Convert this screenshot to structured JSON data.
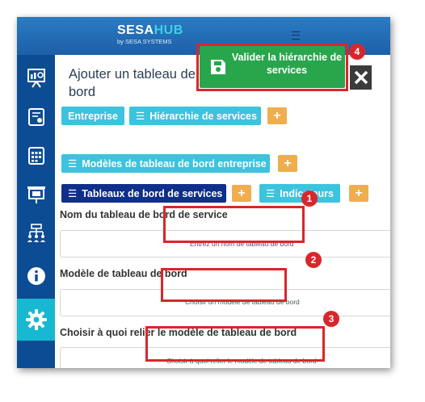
{
  "header": {
    "logo_main": "SESA",
    "logo_accent": "HUB",
    "logo_sub": "by SESA SYSTEMS"
  },
  "sidebar": {
    "items": [
      {
        "icon": "presentation-chart-icon"
      },
      {
        "icon": "certificate-icon"
      },
      {
        "icon": "calendar-grid-icon"
      },
      {
        "icon": "projector-screen-icon"
      },
      {
        "icon": "org-hierarchy-icon"
      },
      {
        "icon": "info-icon"
      },
      {
        "icon": "gear-icon",
        "active": true
      }
    ]
  },
  "page": {
    "title": "Ajouter un tableau de bord"
  },
  "toolbar": {
    "validate_label": "Valider la hiérarchie de services",
    "close_icon": "close-icon"
  },
  "tabs": {
    "entreprise": "Entreprise",
    "hierarchie": "Hiérarchie de services",
    "modeles": "Modèles de tableau de bord entreprise",
    "tableaux": "Tableaux de bord de services",
    "indicateurs": "Indicateurs",
    "plus": "+"
  },
  "form": {
    "name_label": "Nom du tableau de bord de service",
    "name_placeholder": "Entrez un nom de tableau de bord",
    "model_label": "Modèle de tableau de bord",
    "model_placeholder": "Choisir un modèle de tableau de bord",
    "link_label": "Choisir à quoi relier le modèle de tableau de bord",
    "link_placeholder": "Choisir à quoi relier le modèle de tableau de bord"
  },
  "annotations": {
    "badges": [
      "1",
      "2",
      "3",
      "4"
    ]
  },
  "colors": {
    "header": "#1d5fa8",
    "sidebar": "#0c4c95",
    "sidebar_active": "#17b8d2",
    "cyan_tab": "#3cc3de",
    "navy_tab": "#0f2f8a",
    "plus_orange": "#f0ad4e",
    "validate_green": "#29a64c",
    "annotation_red": "#d9262b"
  }
}
